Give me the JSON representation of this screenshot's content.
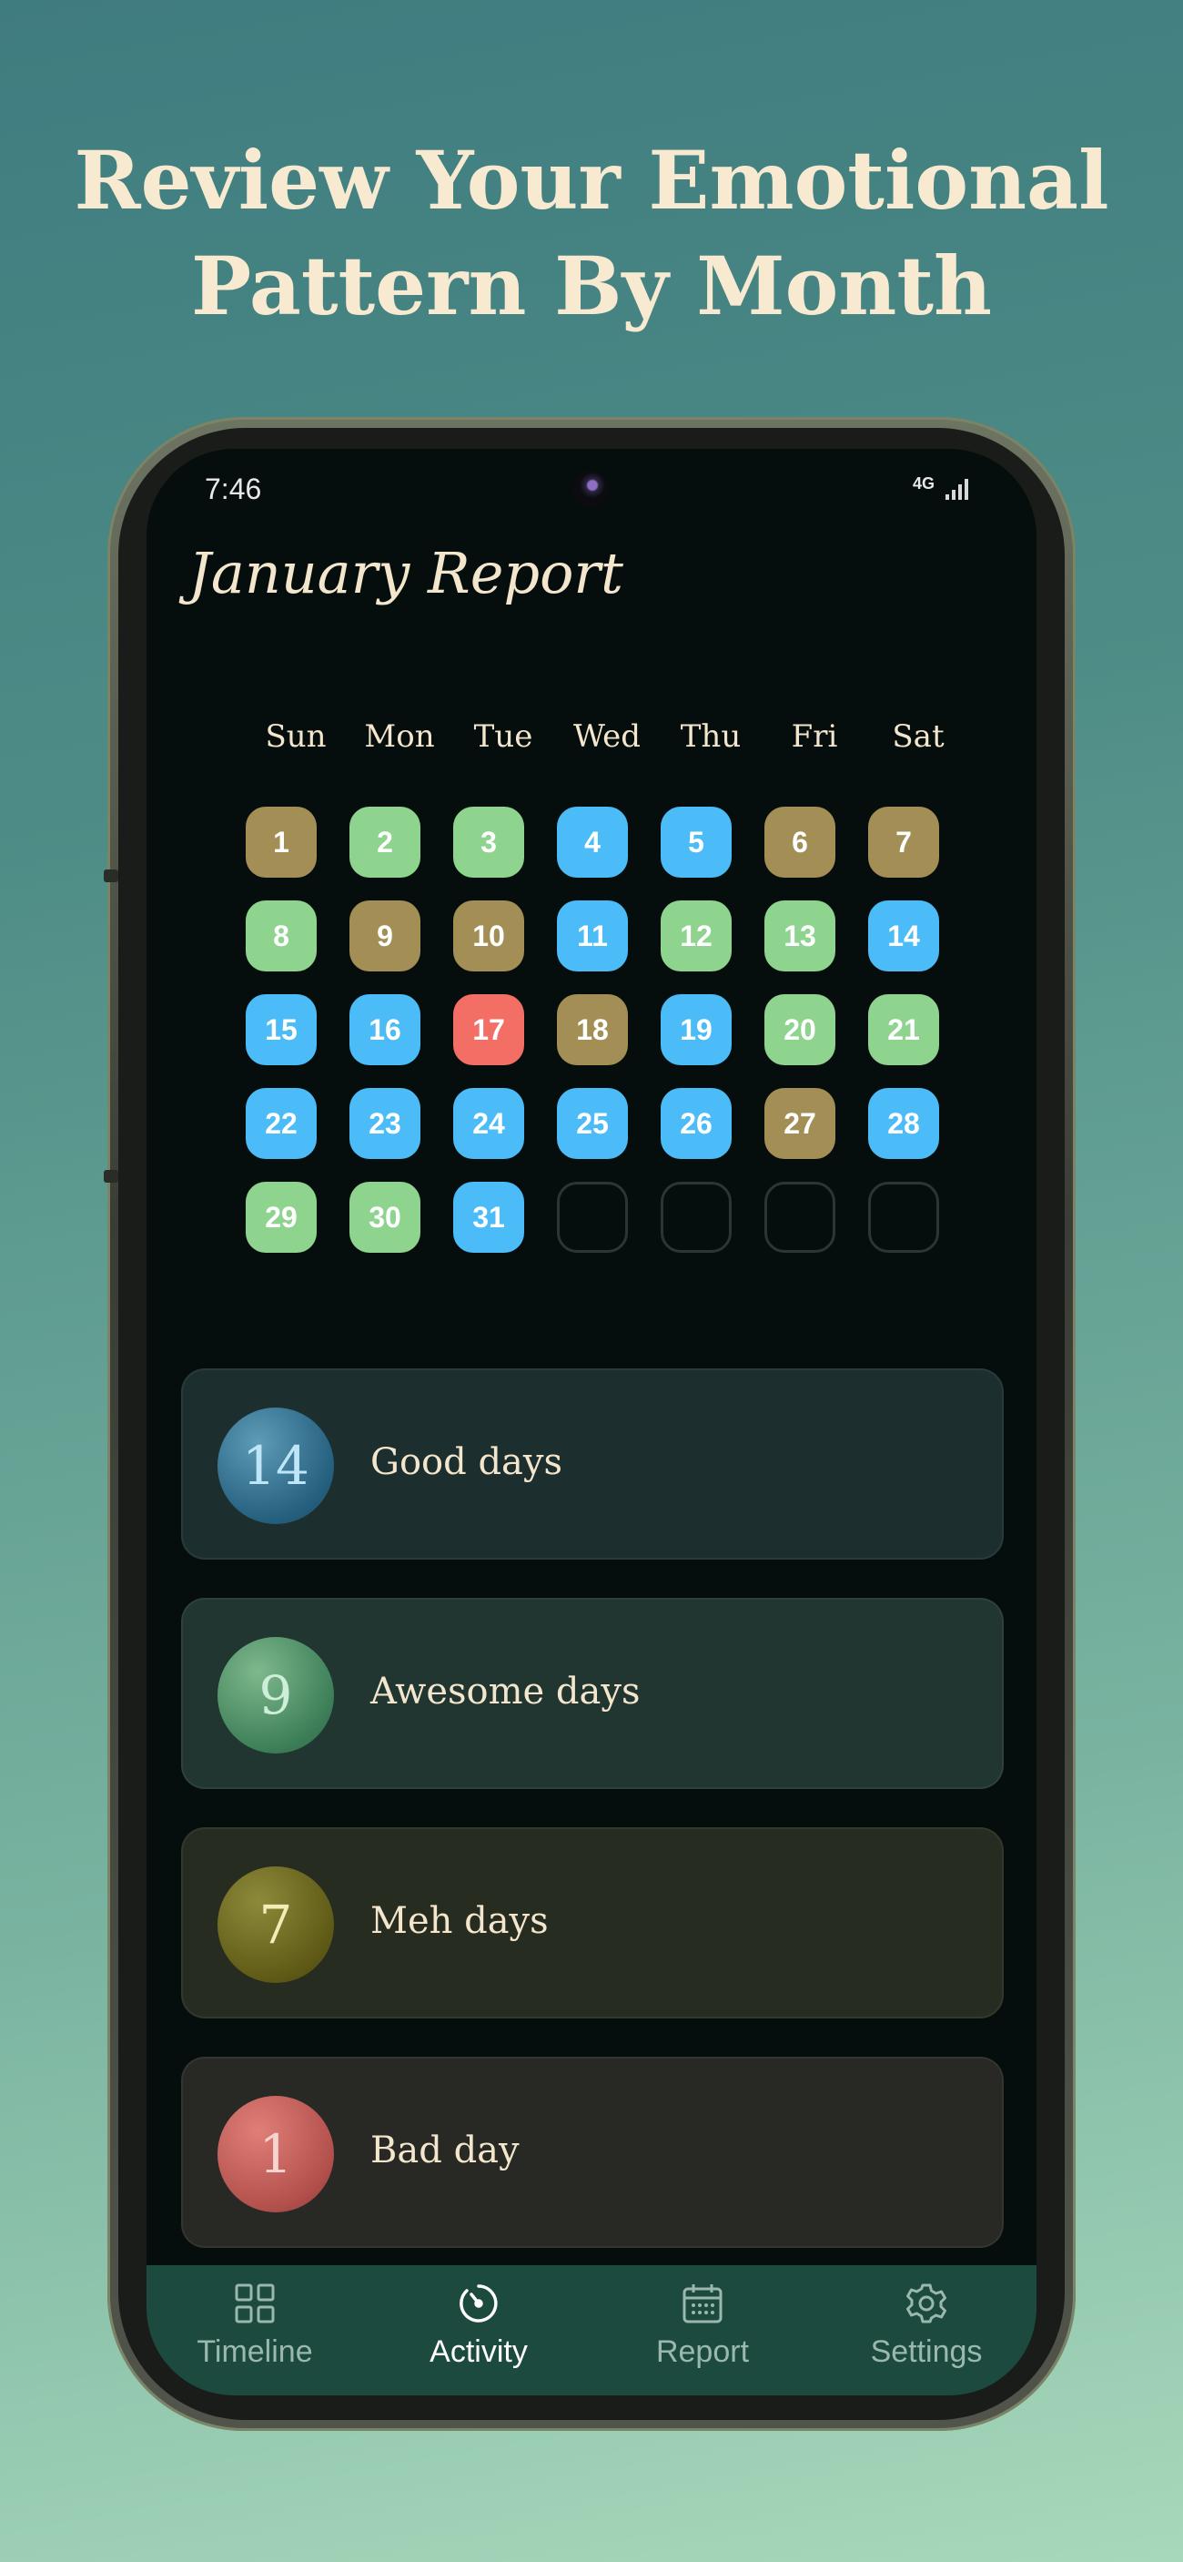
{
  "promo": {
    "headline_line1": "Review Your Emotional",
    "headline_line2": "Pattern By Month"
  },
  "status_bar": {
    "time": "7:46",
    "network": "4G"
  },
  "report": {
    "title": "January Report"
  },
  "calendar": {
    "weekdays": [
      "Sun",
      "Mon",
      "Tue",
      "Wed",
      "Thu",
      "Fri",
      "Sat"
    ],
    "mood_colors": {
      "good": "#4bbcf7",
      "awesome": "#8ed48f",
      "meh": "#a38f55",
      "bad": "#f36f66"
    },
    "days": [
      {
        "day": "1",
        "mood": "meh"
      },
      {
        "day": "2",
        "mood": "awesome"
      },
      {
        "day": "3",
        "mood": "awesome"
      },
      {
        "day": "4",
        "mood": "good"
      },
      {
        "day": "5",
        "mood": "good"
      },
      {
        "day": "6",
        "mood": "meh"
      },
      {
        "day": "7",
        "mood": "meh"
      },
      {
        "day": "8",
        "mood": "awesome"
      },
      {
        "day": "9",
        "mood": "meh"
      },
      {
        "day": "10",
        "mood": "meh"
      },
      {
        "day": "11",
        "mood": "good"
      },
      {
        "day": "12",
        "mood": "awesome"
      },
      {
        "day": "13",
        "mood": "awesome"
      },
      {
        "day": "14",
        "mood": "good"
      },
      {
        "day": "15",
        "mood": "good"
      },
      {
        "day": "16",
        "mood": "good"
      },
      {
        "day": "17",
        "mood": "bad"
      },
      {
        "day": "18",
        "mood": "meh"
      },
      {
        "day": "19",
        "mood": "good"
      },
      {
        "day": "20",
        "mood": "awesome"
      },
      {
        "day": "21",
        "mood": "awesome"
      },
      {
        "day": "22",
        "mood": "good"
      },
      {
        "day": "23",
        "mood": "good"
      },
      {
        "day": "24",
        "mood": "good"
      },
      {
        "day": "25",
        "mood": "good"
      },
      {
        "day": "26",
        "mood": "good"
      },
      {
        "day": "27",
        "mood": "meh"
      },
      {
        "day": "28",
        "mood": "good"
      },
      {
        "day": "29",
        "mood": "awesome"
      },
      {
        "day": "30",
        "mood": "awesome"
      },
      {
        "day": "31",
        "mood": "good"
      },
      {
        "day": "",
        "mood": "empty"
      },
      {
        "day": "",
        "mood": "empty"
      },
      {
        "day": "",
        "mood": "empty"
      },
      {
        "day": "",
        "mood": "empty"
      }
    ]
  },
  "summary": [
    {
      "count": "14",
      "label": "Good days",
      "mood": "good"
    },
    {
      "count": "9",
      "label": "Awesome days",
      "mood": "awesome"
    },
    {
      "count": "7",
      "label": "Meh days",
      "mood": "meh"
    },
    {
      "count": "1",
      "label": "Bad day",
      "mood": "bad"
    }
  ],
  "nav": {
    "items": [
      {
        "label": "Timeline",
        "icon": "grid-icon",
        "active": false
      },
      {
        "label": "Activity",
        "icon": "gauge-icon",
        "active": true
      },
      {
        "label": "Report",
        "icon": "calendar-icon",
        "active": false
      },
      {
        "label": "Settings",
        "icon": "gear-icon",
        "active": false
      }
    ]
  }
}
